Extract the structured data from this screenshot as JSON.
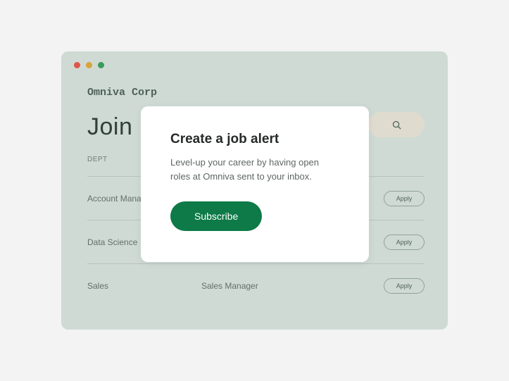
{
  "window": {
    "company": "Omniva Corp",
    "heading": "Join u"
  },
  "table": {
    "header_dept": "DEPT",
    "rows": [
      {
        "dept": "Account Manag",
        "role": "",
        "apply": "Apply"
      },
      {
        "dept": "Data Science",
        "role": "",
        "apply": "Apply"
      },
      {
        "dept": "Sales",
        "role": "Sales Manager",
        "apply": "Apply"
      }
    ]
  },
  "modal": {
    "title": "Create a job alert",
    "body": "Level-up your career by having open roles at Omniva sent  to your inbox.",
    "subscribe": "Subscribe"
  },
  "icons": {
    "search": "search-icon"
  }
}
